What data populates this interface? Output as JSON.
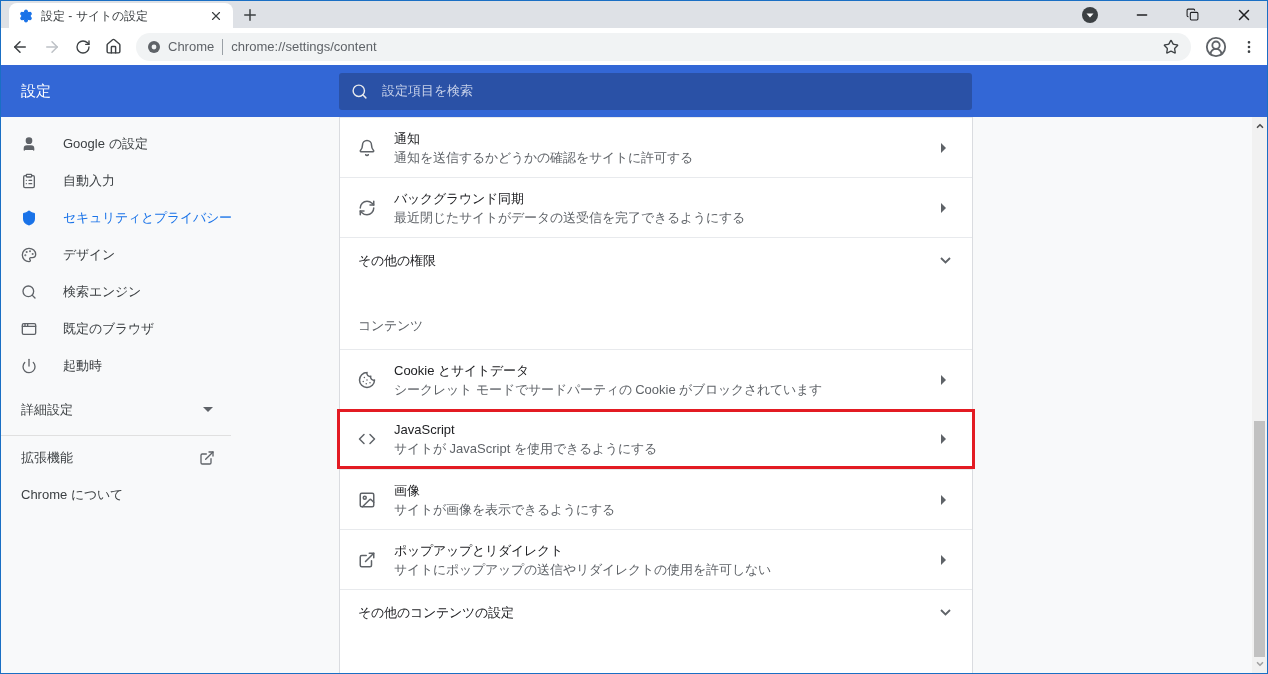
{
  "browser": {
    "tab": {
      "title": "設定 - サイトの設定",
      "selected": true
    },
    "address": {
      "origin": "Chrome",
      "url": "chrome://settings/content"
    }
  },
  "header": {
    "title": "設定",
    "search": {
      "placeholder": "設定項目を検索"
    }
  },
  "sidebar": {
    "items": [
      {
        "label": "Google の設定",
        "selected": false
      },
      {
        "label": "自動入力",
        "selected": false
      },
      {
        "label": "セキュリティとプライバシー",
        "selected": true
      },
      {
        "label": "デザイン",
        "selected": false
      },
      {
        "label": "検索エンジン",
        "selected": false
      },
      {
        "label": "既定のブラウザ",
        "selected": false
      },
      {
        "label": "起動時",
        "selected": false
      }
    ],
    "advanced": {
      "label": "詳細設定",
      "expanded": false
    },
    "extensions": {
      "label": "拡張機能"
    },
    "about": {
      "label": "Chrome について"
    }
  },
  "permissions": {
    "rows": [
      {
        "title": "通知",
        "subtitle": "通知を送信するかどうかの確認をサイトに許可する",
        "highlighted": false
      },
      {
        "title": "バックグラウンド同期",
        "subtitle": "最近閉じたサイトがデータの送受信を完了できるようにする",
        "highlighted": false
      }
    ],
    "more": {
      "label": "その他の権限",
      "expanded": false
    }
  },
  "content": {
    "heading": "コンテンツ",
    "rows": [
      {
        "title": "Cookie とサイトデータ",
        "subtitle": "シークレット モードでサードパーティの Cookie がブロックされています",
        "highlighted": false
      },
      {
        "title": "JavaScript",
        "subtitle": "サイトが JavaScript を使用できるようにする",
        "highlighted": true
      },
      {
        "title": "画像",
        "subtitle": "サイトが画像を表示できるようにする",
        "highlighted": false
      },
      {
        "title": "ポップアップとリダイレクト",
        "subtitle": "サイトにポップアップの送信やリダイレクトの使用を許可しない",
        "highlighted": false
      }
    ],
    "more": {
      "label": "その他のコンテンツの設定",
      "expanded": false
    }
  }
}
